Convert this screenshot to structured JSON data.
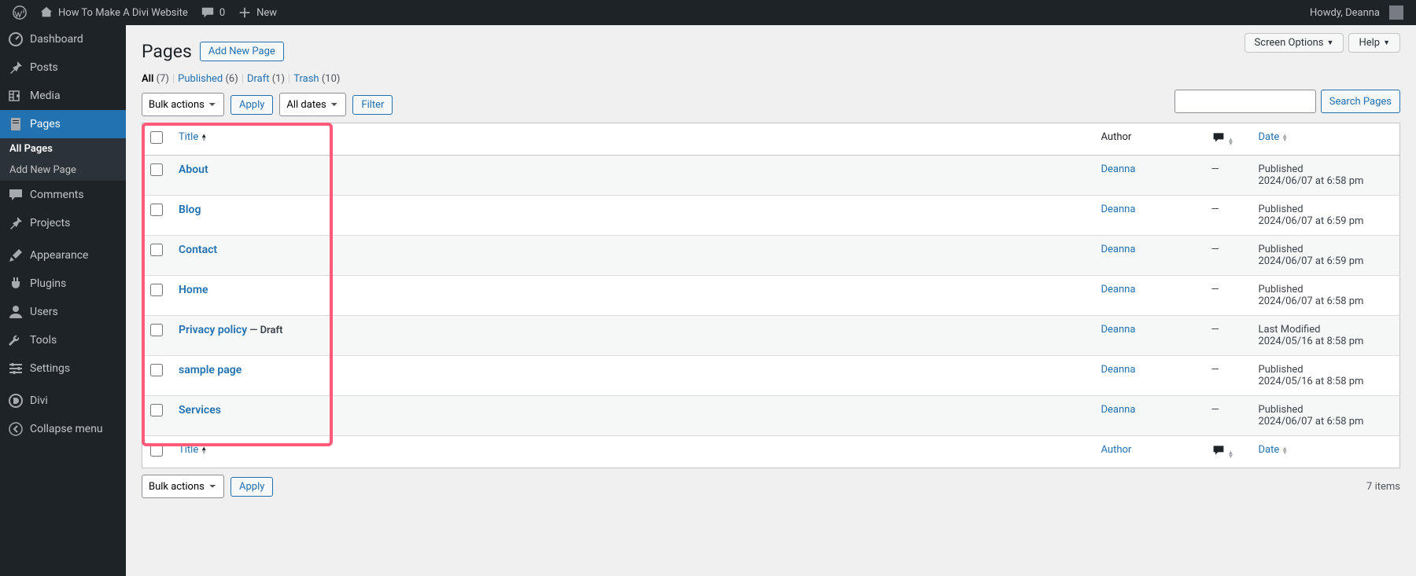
{
  "adminbar": {
    "site_title": "How To Make A Divi Website",
    "comments_count": "0",
    "new_label": "New",
    "howdy": "Howdy, Deanna"
  },
  "sidebar": {
    "items": [
      {
        "label": "Dashboard",
        "icon": "dashboard"
      },
      {
        "label": "Posts",
        "icon": "pin"
      },
      {
        "label": "Media",
        "icon": "media"
      },
      {
        "label": "Pages",
        "icon": "page",
        "current": true
      },
      {
        "label": "Comments",
        "icon": "comment"
      },
      {
        "label": "Projects",
        "icon": "pin"
      },
      {
        "label": "Appearance",
        "icon": "brush"
      },
      {
        "label": "Plugins",
        "icon": "plugin"
      },
      {
        "label": "Users",
        "icon": "user"
      },
      {
        "label": "Tools",
        "icon": "wrench"
      },
      {
        "label": "Settings",
        "icon": "settings"
      },
      {
        "label": "Divi",
        "icon": "divi"
      },
      {
        "label": "Collapse menu",
        "icon": "collapse"
      }
    ],
    "submenu": [
      {
        "label": "All Pages",
        "current": true
      },
      {
        "label": "Add New Page"
      }
    ]
  },
  "top_buttons": {
    "screen_options": "Screen Options",
    "help": "Help"
  },
  "page": {
    "heading": "Pages",
    "add_new": "Add New Page",
    "views": {
      "all_label": "All",
      "all_count": "(7)",
      "published_label": "Published",
      "published_count": "(6)",
      "draft_label": "Draft",
      "draft_count": "(1)",
      "trash_label": "Trash",
      "trash_count": "(10)"
    },
    "bulk_actions": "Bulk actions",
    "apply": "Apply",
    "all_dates": "All dates",
    "filter": "Filter",
    "search": "Search Pages",
    "items_count": "7 items",
    "columns": {
      "title": "Title",
      "author": "Author",
      "date": "Date"
    }
  },
  "rows": [
    {
      "title": "About",
      "author": "Deanna",
      "comments": "—",
      "date_status": "Published",
      "date_value": "2024/06/07 at 6:58 pm"
    },
    {
      "title": "Blog",
      "author": "Deanna",
      "comments": "—",
      "date_status": "Published",
      "date_value": "2024/06/07 at 6:59 pm"
    },
    {
      "title": "Contact",
      "author": "Deanna",
      "comments": "—",
      "date_status": "Published",
      "date_value": "2024/06/07 at 6:59 pm"
    },
    {
      "title": "Home",
      "author": "Deanna",
      "comments": "—",
      "date_status": "Published",
      "date_value": "2024/06/07 at 6:58 pm"
    },
    {
      "title": "Privacy policy",
      "state": " — Draft",
      "author": "Deanna",
      "comments": "—",
      "date_status": "Last Modified",
      "date_value": "2024/05/16 at 8:58 pm"
    },
    {
      "title": "sample page",
      "author": "Deanna",
      "comments": "—",
      "date_status": "Published",
      "date_value": "2024/05/16 at 8:58 pm"
    },
    {
      "title": "Services",
      "author": "Deanna",
      "comments": "—",
      "date_status": "Published",
      "date_value": "2024/06/07 at 6:58 pm"
    }
  ]
}
